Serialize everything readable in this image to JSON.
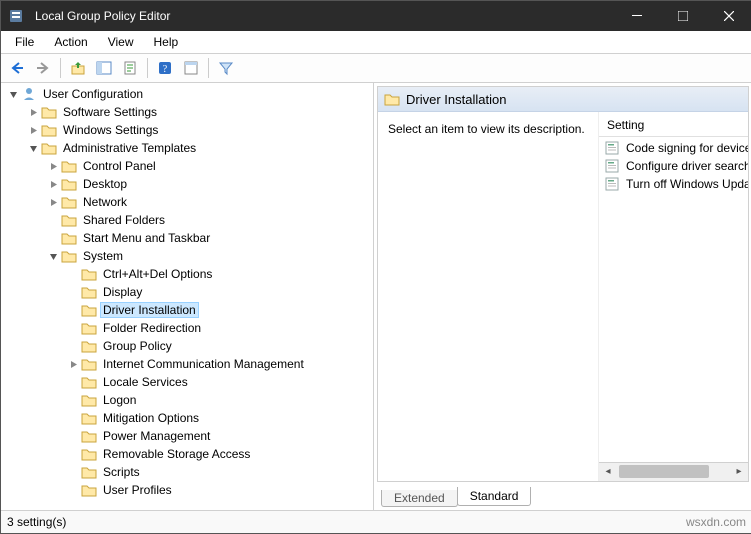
{
  "window": {
    "title": "Local Group Policy Editor"
  },
  "menu": {
    "file": "File",
    "action": "Action",
    "view": "View",
    "help": "Help"
  },
  "tree": {
    "root": "User Configuration",
    "items": [
      {
        "label": "Software Settings",
        "indent": 1,
        "exp": "closed"
      },
      {
        "label": "Windows Settings",
        "indent": 1,
        "exp": "closed"
      },
      {
        "label": "Administrative Templates",
        "indent": 1,
        "exp": "open"
      },
      {
        "label": "Control Panel",
        "indent": 2,
        "exp": "closed"
      },
      {
        "label": "Desktop",
        "indent": 2,
        "exp": "closed"
      },
      {
        "label": "Network",
        "indent": 2,
        "exp": "closed"
      },
      {
        "label": "Shared Folders",
        "indent": 2
      },
      {
        "label": "Start Menu and Taskbar",
        "indent": 2
      },
      {
        "label": "System",
        "indent": 2,
        "exp": "open"
      },
      {
        "label": "Ctrl+Alt+Del Options",
        "indent": 3
      },
      {
        "label": "Display",
        "indent": 3
      },
      {
        "label": "Driver Installation",
        "indent": 3,
        "selected": true
      },
      {
        "label": "Folder Redirection",
        "indent": 3
      },
      {
        "label": "Group Policy",
        "indent": 3
      },
      {
        "label": "Internet Communication Management",
        "indent": 3,
        "exp": "closed"
      },
      {
        "label": "Locale Services",
        "indent": 3
      },
      {
        "label": "Logon",
        "indent": 3
      },
      {
        "label": "Mitigation Options",
        "indent": 3
      },
      {
        "label": "Power Management",
        "indent": 3
      },
      {
        "label": "Removable Storage Access",
        "indent": 3
      },
      {
        "label": "Scripts",
        "indent": 3
      },
      {
        "label": "User Profiles",
        "indent": 3
      }
    ]
  },
  "detail": {
    "header": "Driver Installation",
    "description": "Select an item to view its description.",
    "column_header": "Setting",
    "settings": [
      "Code signing for device drivers",
      "Configure driver search locations",
      "Turn off Windows Update device driver search"
    ]
  },
  "tabs": {
    "extended": "Extended",
    "standard": "Standard"
  },
  "status": {
    "left": "3 setting(s)",
    "right": "wsxdn.com"
  }
}
